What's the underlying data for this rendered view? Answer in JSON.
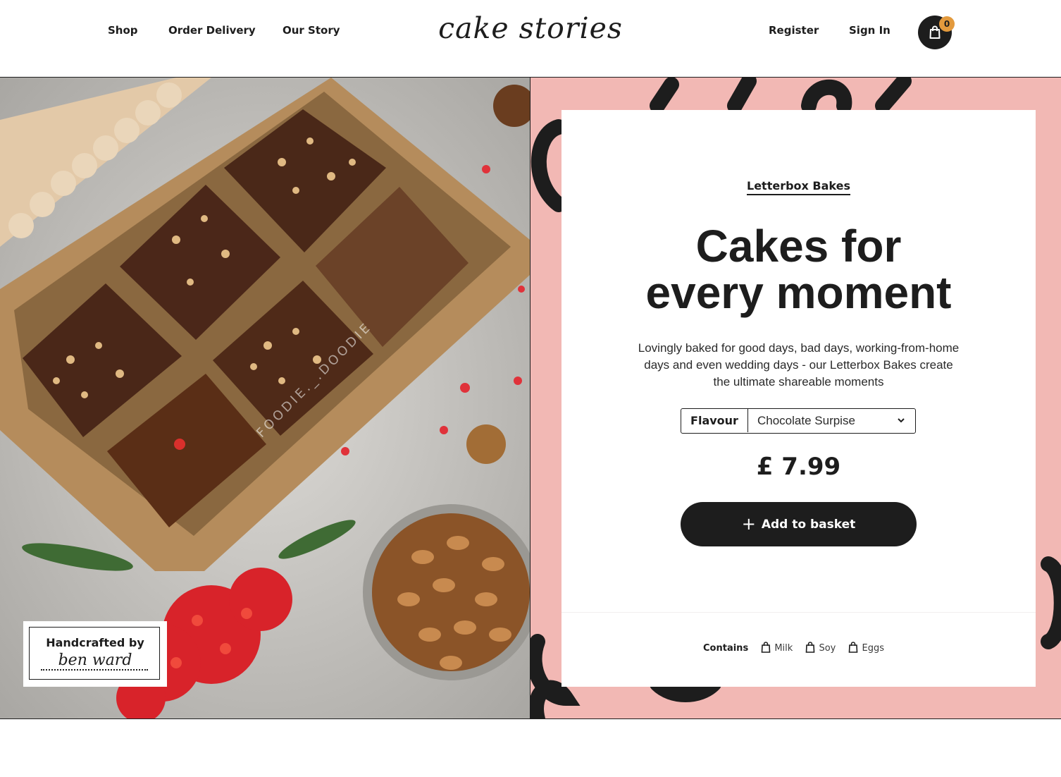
{
  "nav": {
    "left_links": [
      "Shop",
      "Order Delivery",
      "Our Story"
    ],
    "logo": "cake stories",
    "right_links": [
      "Register",
      "Sign In"
    ],
    "basket_count": "0"
  },
  "product": {
    "eyebrow": "Letterbox Bakes",
    "title_line1": "Cakes for",
    "title_line2": "every moment",
    "description": "Lovingly baked for good days, bad days, working-from-home days and even wedding days - our Letterbox Bakes create the ultimate shareable moments",
    "flavour_label": "Flavour",
    "flavour_value": "Chocolate Surpise",
    "price": "£ 7.99",
    "add_button": "Add to basket",
    "contains_label": "Contains",
    "allergens": [
      "Milk",
      "Soy",
      "Eggs"
    ]
  },
  "photo": {
    "badge_line1": "Handcrafted by",
    "badge_line2": "ben ward",
    "watermark": "FOODIE._.DOODIE"
  },
  "colors": {
    "ink": "#1d1d1d",
    "pink_panel": "#f2b8b4",
    "badge_orange": "#e39a3d"
  }
}
